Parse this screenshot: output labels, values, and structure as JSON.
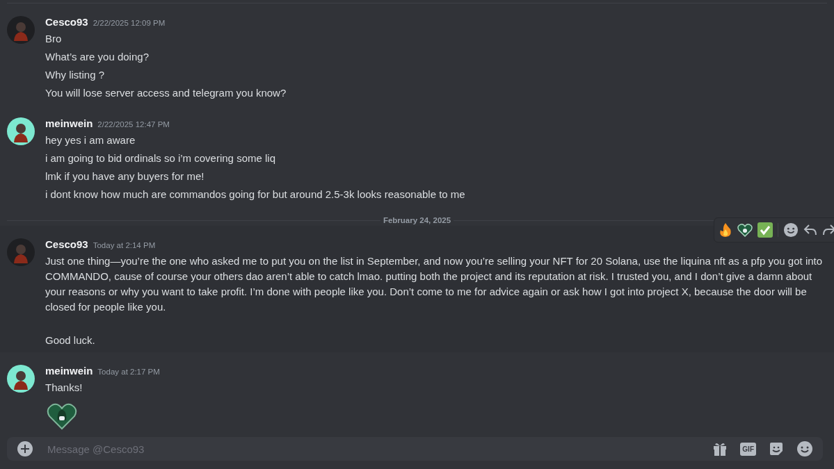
{
  "groups": [
    {
      "kind": "messages",
      "author": "Cesco93",
      "color": "#1e1f22",
      "timestamp": "2/22/2025 12:09 PM",
      "hovered": false,
      "lines": [
        "Bro",
        "What’s are you doing?",
        "Why listing ?",
        "You will lose server access and telegram you know?"
      ]
    },
    {
      "kind": "messages",
      "author": "meinwein",
      "color": "#7de8d0",
      "timestamp": "2/22/2025 12:47 PM",
      "hovered": false,
      "lines": [
        "hey yes i am aware",
        "i am going to bid ordinals so i’m covering some liq",
        "lmk if you have any buyers for me!",
        "i dont know how much are commandos going for but around 2.5-3k looks reasonable to me"
      ]
    },
    {
      "kind": "divider",
      "date": "February 24, 2025"
    },
    {
      "kind": "messages",
      "author": "Cesco93",
      "color": "#1e1f22",
      "timestamp": "Today at 2:14 PM",
      "hovered": true,
      "lines": [
        "Just one thing—you’re the one who asked me to put you on the list in September, and now you’re selling your NFT for 20 Solana, use the liquina nft as a pfp you got into COMMANDO, cause of course your others dao aren’t able to catch lmao. putting both the project and its reputation at risk. I trusted you, and I don’t give a damn about your reasons or why you want to take profit. I’m done with people like you. Don’t come to me for advice again or ask how I got into project X, because the door will be closed for people like you.",
        "Good luck."
      ]
    },
    {
      "kind": "messages",
      "author": "meinwein",
      "color": "#7de8d0",
      "timestamp": "Today at 2:17 PM",
      "hovered": false,
      "lines": [
        "Thanks!"
      ],
      "sticker": true
    }
  ],
  "composer": {
    "placeholder": "Message @Cesco93",
    "gif_label": "GIF"
  }
}
